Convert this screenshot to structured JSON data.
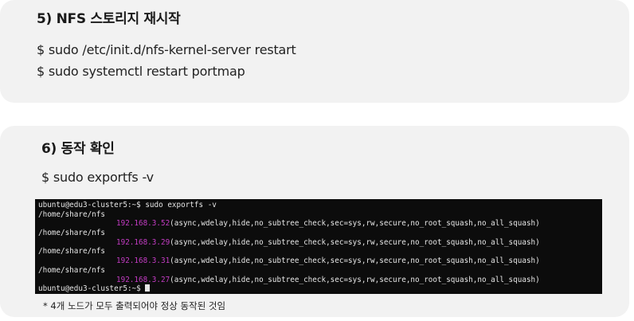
{
  "section5": {
    "title": "5) NFS 스토리지 재시작",
    "commands": [
      "$ sudo /etc/init.d/nfs-kernel-server restart",
      "$ sudo systemctl restart portmap"
    ]
  },
  "section6": {
    "title": "6) 동작 확인",
    "command": "$ sudo exportfs -v",
    "terminal": {
      "prompt_line": "ubuntu@edu3-cluster5:~$ sudo exportfs -v",
      "entries": [
        {
          "path": "/home/share/nfs",
          "ip": "192.168.3.52",
          "options": "(async,wdelay,hide,no_subtree_check,sec=sys,rw,secure,no_root_squash,no_all_squash)"
        },
        {
          "path": "/home/share/nfs",
          "ip": "192.168.3.29",
          "options": "(async,wdelay,hide,no_subtree_check,sec=sys,rw,secure,no_root_squash,no_all_squash)"
        },
        {
          "path": "/home/share/nfs",
          "ip": "192.168.3.31",
          "options": "(async,wdelay,hide,no_subtree_check,sec=sys,rw,secure,no_root_squash,no_all_squash)"
        },
        {
          "path": "/home/share/nfs",
          "ip": "192.168.3.27",
          "options": "(async,wdelay,hide,no_subtree_check,sec=sys,rw,secure,no_root_squash,no_all_squash)"
        }
      ],
      "final_prompt": "ubuntu@edu3-cluster5:~$ "
    },
    "note": "* 4개 노드가 모두 출력되어야 정상 동작된 것임"
  },
  "colors": {
    "card_bg": "#f2f2f2",
    "terminal_bg": "#0c0c0c",
    "ip_color": "#c43cc4"
  }
}
